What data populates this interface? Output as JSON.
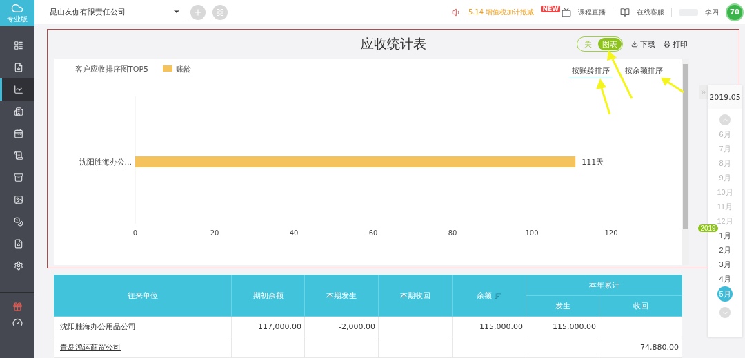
{
  "sidebar": {
    "logo_label": "专业版",
    "items": [
      {
        "selected": false
      },
      {
        "selected": false
      },
      {
        "selected": true
      },
      {
        "selected": false
      },
      {
        "selected": false
      },
      {
        "selected": false
      },
      {
        "selected": false
      },
      {
        "selected": false
      },
      {
        "selected": false
      },
      {
        "selected": false
      },
      {
        "selected": false
      }
    ]
  },
  "topbar": {
    "company": "昆山友伽有限责任公司",
    "promo": "5.14 增值税加计抵减",
    "new_badge": "NEW",
    "live_course": "课程直播",
    "support": "在线客服",
    "user": "李四",
    "score": "70"
  },
  "report": {
    "title": "应收统计表",
    "view_toggle": [
      {
        "label": "关",
        "selected": false
      },
      {
        "label": "图表",
        "selected": true
      }
    ],
    "download": "下载",
    "print": "打印",
    "sort_tabs": [
      {
        "label": "按账龄排序",
        "selected": true
      },
      {
        "label": "按余额排序",
        "selected": false
      }
    ],
    "chart_data": {
      "type": "bar",
      "orientation": "horizontal",
      "title": "客户应收排序图TOP5",
      "categories": [
        "沈阳胜海办公..."
      ],
      "series": [
        {
          "name": "账龄",
          "color": "#f5c35c",
          "values": [
            111
          ]
        }
      ],
      "xlim": [
        0,
        120
      ],
      "xticks": [
        0,
        20,
        40,
        60,
        80,
        100,
        120
      ],
      "value_labels": [
        "111天"
      ]
    }
  },
  "date_panel": {
    "current": "2019.05",
    "year_badge": "2019",
    "months": [
      {
        "label": "6月",
        "selected": false,
        "disabled": true
      },
      {
        "label": "7月",
        "selected": false,
        "disabled": true
      },
      {
        "label": "8月",
        "selected": false,
        "disabled": true
      },
      {
        "label": "9月",
        "selected": false,
        "disabled": true
      },
      {
        "label": "10月",
        "selected": false,
        "disabled": true
      },
      {
        "label": "11月",
        "selected": false,
        "disabled": true
      },
      {
        "label": "12月",
        "selected": false,
        "disabled": true
      },
      {
        "label": "1月",
        "selected": false,
        "disabled": false
      },
      {
        "label": "2月",
        "selected": false,
        "disabled": false
      },
      {
        "label": "3月",
        "selected": false,
        "disabled": false
      },
      {
        "label": "4月",
        "selected": false,
        "disabled": false
      },
      {
        "label": "5月",
        "selected": true,
        "disabled": false
      }
    ]
  },
  "table": {
    "columns": [
      "往来单位",
      "期初余额",
      "本期发生",
      "本期收回",
      "余额"
    ],
    "group": {
      "label": "本年累计",
      "columns": [
        "发生",
        "收回"
      ]
    },
    "rows": [
      [
        "沈阳胜海办公用品公司",
        "117,000.00",
        "-2,000.00",
        "",
        "115,000.00",
        "115,000.00",
        ""
      ],
      [
        "青岛鸿运商贸公司",
        "",
        "",
        "",
        "",
        "",
        "74,880.00"
      ]
    ]
  }
}
